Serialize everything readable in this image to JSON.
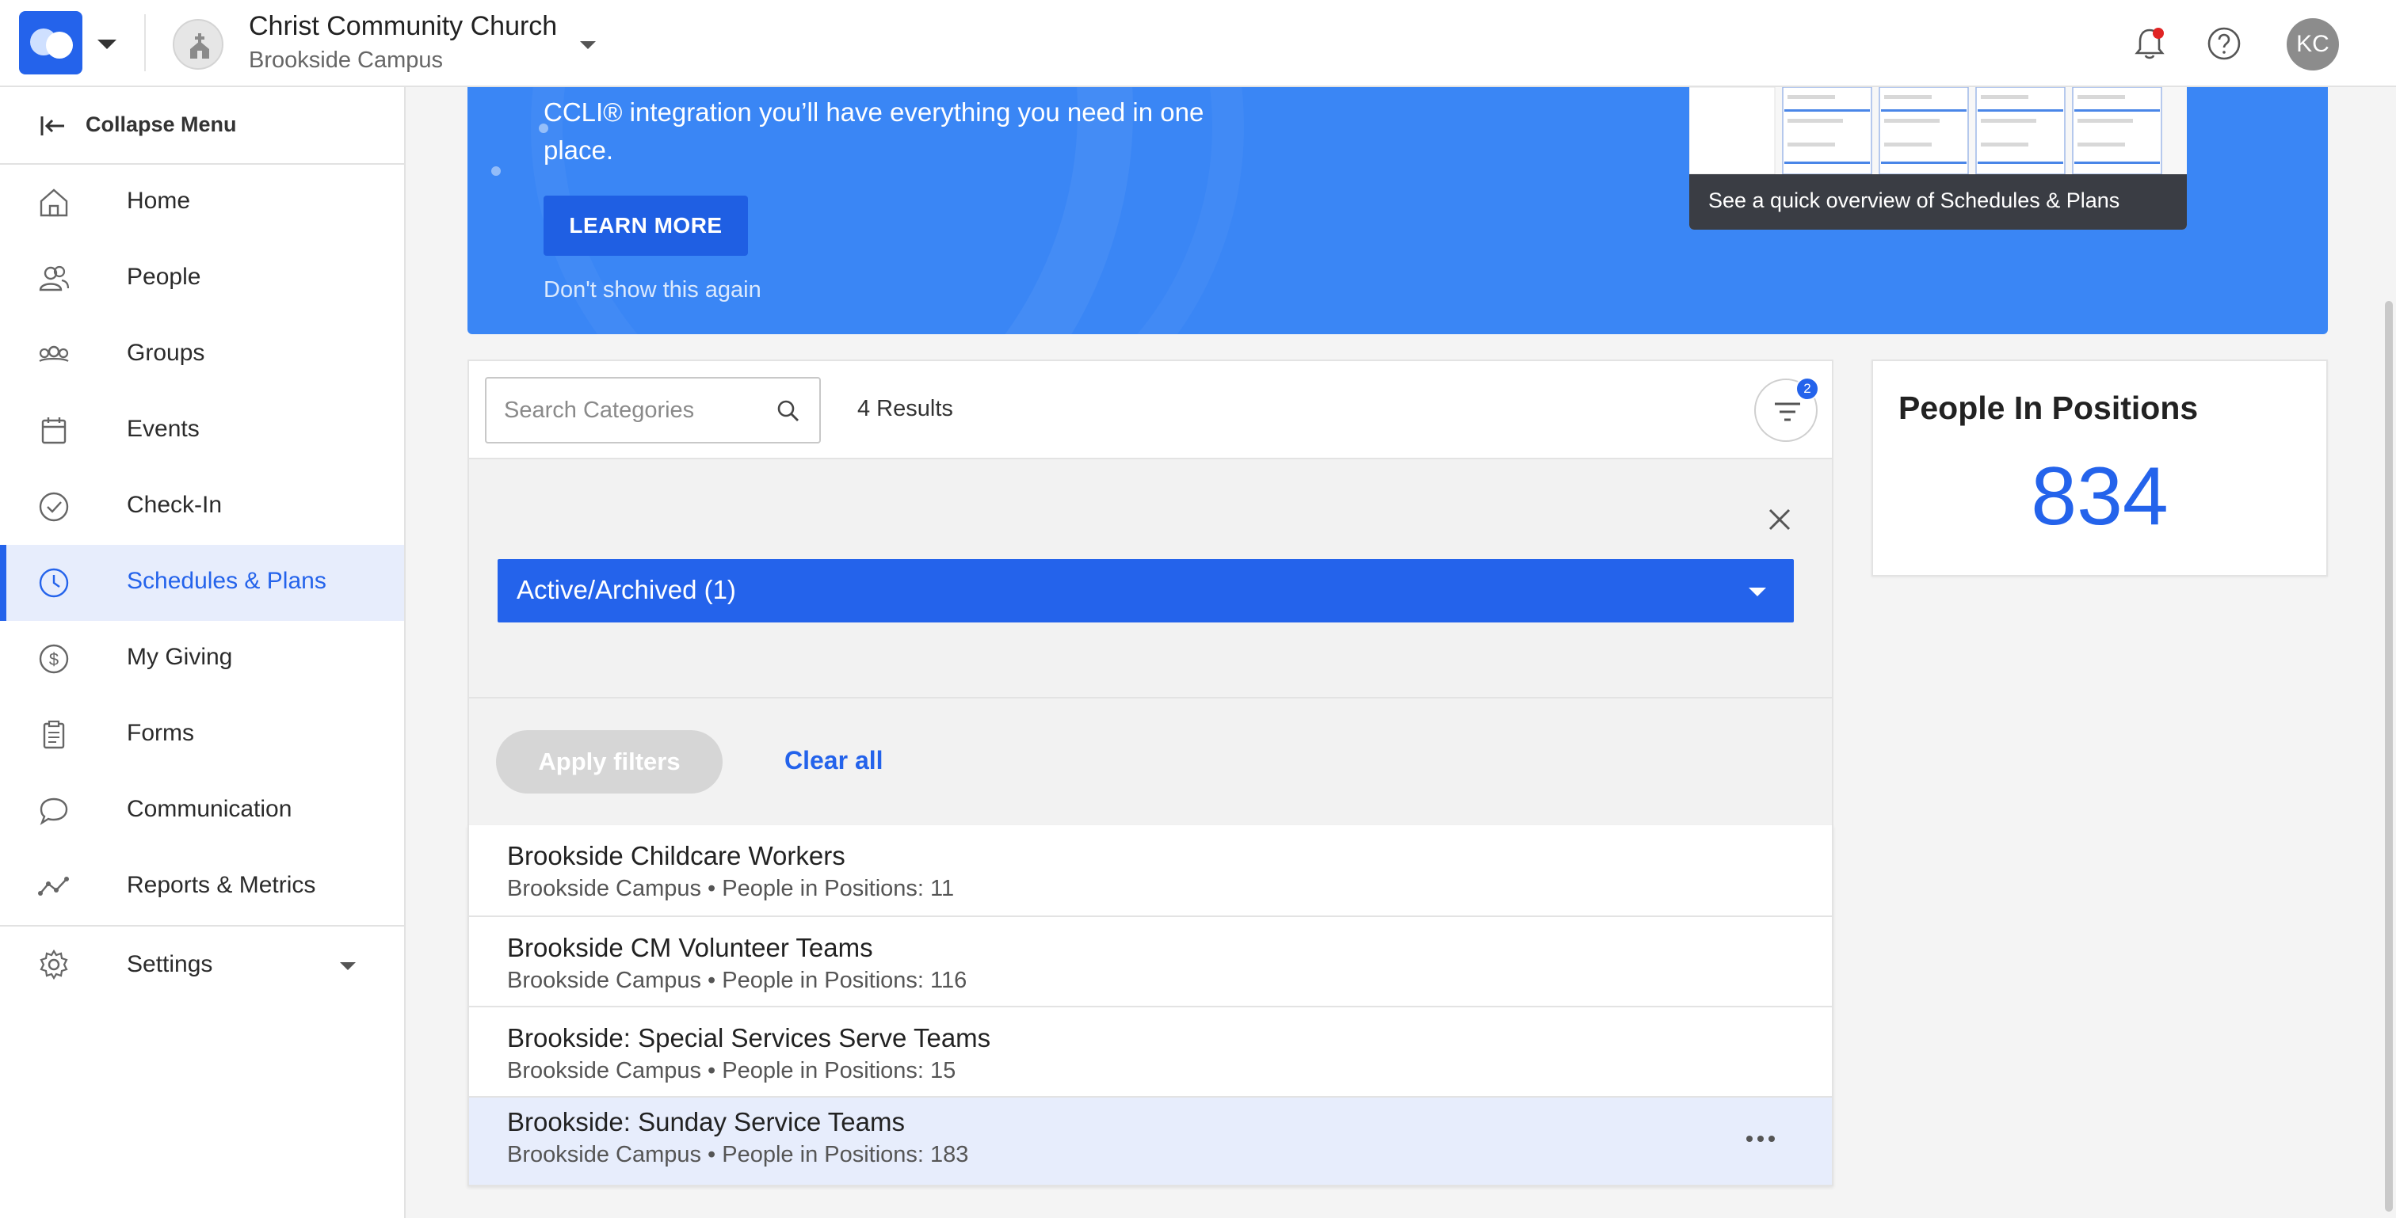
{
  "topbar": {
    "church_name": "Christ Community Church",
    "campus": "Brookside Campus",
    "user_initials": "KC",
    "brand_color": "#2463eb"
  },
  "sidebar": {
    "collapse_label": "Collapse Menu",
    "items": [
      {
        "label": "Home",
        "icon": "home-icon"
      },
      {
        "label": "People",
        "icon": "people-icon"
      },
      {
        "label": "Groups",
        "icon": "groups-icon"
      },
      {
        "label": "Events",
        "icon": "calendar-icon"
      },
      {
        "label": "Check-In",
        "icon": "check-circle-icon"
      },
      {
        "label": "Schedules & Plans",
        "icon": "clock-icon",
        "active": true
      },
      {
        "label": "My Giving",
        "icon": "dollar-icon"
      },
      {
        "label": "Forms",
        "icon": "clipboard-icon"
      },
      {
        "label": "Communication",
        "icon": "chat-icon"
      },
      {
        "label": "Reports & Metrics",
        "icon": "chart-icon"
      }
    ],
    "settings_label": "Settings"
  },
  "banner": {
    "text_line1": "CCLI® integration you’ll have everything you need in one",
    "text_line2": "place.",
    "learn_more": "LEARN MORE",
    "dont_show": "Don't show this again",
    "video_caption": "See a quick overview of Schedules & Plans",
    "color": "#3a86f5"
  },
  "search": {
    "placeholder": "Search Categories",
    "results": "4 Results",
    "filter_count": "2"
  },
  "filters": {
    "dropdown_label": "Active/Archived (1)",
    "apply_label": "Apply filters",
    "clear_label": "Clear all"
  },
  "list": {
    "rows": [
      {
        "title": "Brookside Childcare Workers",
        "subtitle": "Brookside Campus • People in Positions: 11"
      },
      {
        "title": "Brookside CM Volunteer Teams",
        "subtitle": "Brookside Campus • People in Positions: 116"
      },
      {
        "title": "Brookside: Special Services Serve Teams",
        "subtitle": "Brookside Campus • People in Positions: 15"
      },
      {
        "title": "Brookside: Sunday Service Teams",
        "subtitle": "Brookside Campus • People in Positions: 183"
      }
    ]
  },
  "stats": {
    "title": "People In Positions",
    "value": "834"
  }
}
